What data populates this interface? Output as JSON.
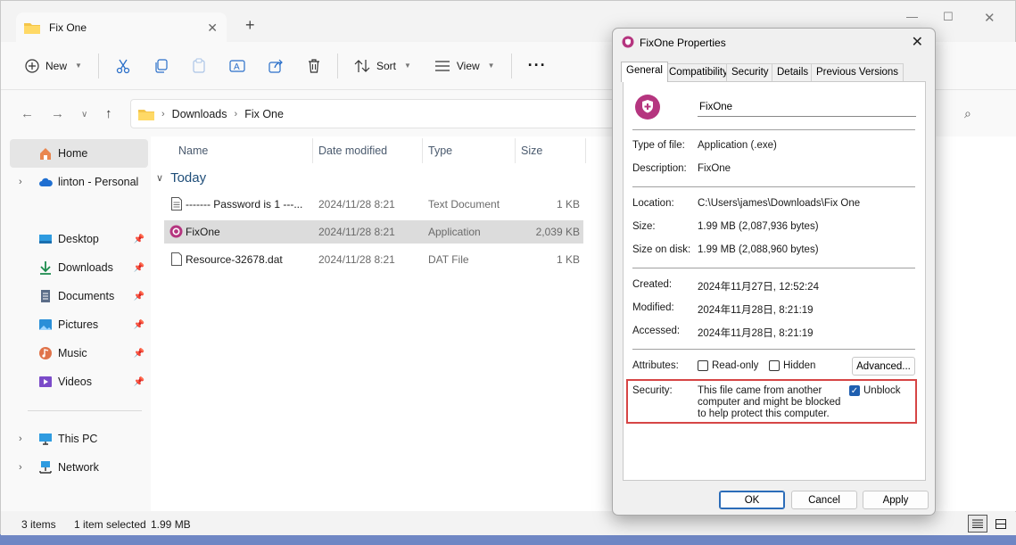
{
  "explorer": {
    "tab_title": "Fix One",
    "toolbar": {
      "new_label": "New",
      "sort_label": "Sort",
      "view_label": "View"
    },
    "breadcrumb": [
      "Downloads",
      "Fix One"
    ],
    "sidebar": {
      "home": "Home",
      "onedrive": "linton - Personal",
      "quick": [
        {
          "label": "Desktop",
          "icon": "desktop-icon"
        },
        {
          "label": "Downloads",
          "icon": "downloads-icon"
        },
        {
          "label": "Documents",
          "icon": "documents-icon"
        },
        {
          "label": "Pictures",
          "icon": "pictures-icon"
        },
        {
          "label": "Music",
          "icon": "music-icon"
        },
        {
          "label": "Videos",
          "icon": "videos-icon"
        }
      ],
      "this_pc": "This PC",
      "network": "Network"
    },
    "columns": {
      "name": "Name",
      "date": "Date modified",
      "type": "Type",
      "size": "Size"
    },
    "group_label": "Today",
    "files": [
      {
        "name": "------- Password is 1 ---...",
        "date": "2024/11/28 8:21",
        "type": "Text Document",
        "size": "1 KB",
        "icon": "text-file-icon"
      },
      {
        "name": "FixOne",
        "date": "2024/11/28 8:21",
        "type": "Application",
        "size": "2,039 KB",
        "icon": "app-icon"
      },
      {
        "name": "Resource-32678.dat",
        "date": "2024/11/28 8:21",
        "type": "DAT File",
        "size": "1 KB",
        "icon": "dat-file-icon"
      }
    ],
    "status": {
      "items": "3 items",
      "selected": "1 item selected",
      "size": "1.99 MB"
    }
  },
  "dialog": {
    "title": "FixOne Properties",
    "tabs": [
      "General",
      "Compatibility",
      "Security",
      "Details",
      "Previous Versions"
    ],
    "file_name": "FixOne",
    "type_label": "Type of file:",
    "type_value": "Application (.exe)",
    "desc_label": "Description:",
    "desc_value": "FixOne",
    "location_label": "Location:",
    "location_value": "C:\\Users\\james\\Downloads\\Fix One",
    "size_label": "Size:",
    "size_value": "1.99 MB (2,087,936 bytes)",
    "disk_label": "Size on disk:",
    "disk_value": "1.99 MB (2,088,960 bytes)",
    "created_label": "Created:",
    "created_value": "2024年11月27日, 12:52:24",
    "modified_label": "Modified:",
    "modified_value": "2024年11月28日, 8:21:19",
    "accessed_label": "Accessed:",
    "accessed_value": "2024年11月28日, 8:21:19",
    "attributes_label": "Attributes:",
    "readonly_label": "Read-only",
    "hidden_label": "Hidden",
    "advanced_label": "Advanced...",
    "security_label": "Security:",
    "security_text": "This file came from another computer and might be blocked to help protect this computer.",
    "unblock_label": "Unblock",
    "ok_label": "OK",
    "cancel_label": "Cancel",
    "apply_label": "Apply"
  },
  "colors": {
    "accent": "#1f5fb0",
    "highlight": "#d64545",
    "app_icon": "#b5357f"
  }
}
